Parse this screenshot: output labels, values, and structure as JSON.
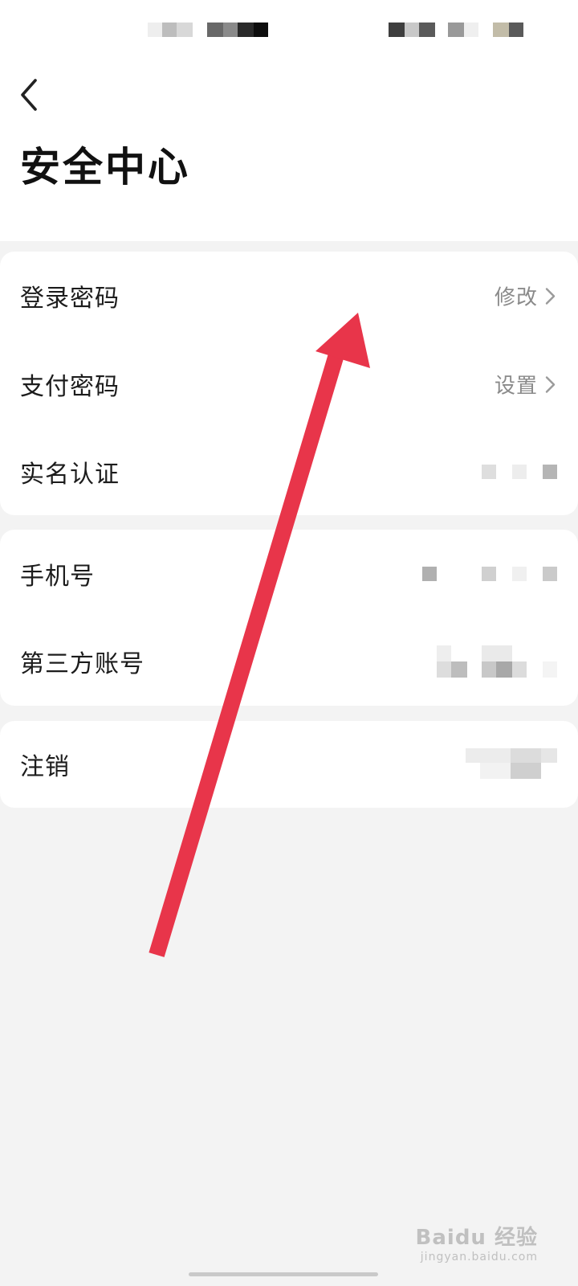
{
  "header": {
    "title": "安全中心",
    "back_icon": "chevron-left-icon"
  },
  "groups": [
    {
      "rows": [
        {
          "label": "登录密码",
          "action": "修改",
          "icon": "chevron-right-icon"
        },
        {
          "label": "支付密码",
          "action": "设置",
          "icon": "chevron-right-icon"
        },
        {
          "label": "实名认证"
        }
      ]
    },
    {
      "rows": [
        {
          "label": "手机号"
        },
        {
          "label": "第三方账号"
        }
      ]
    },
    {
      "rows": [
        {
          "label": "注销"
        }
      ]
    }
  ],
  "annotation": {
    "arrow_color": "#e8354a"
  },
  "watermark": {
    "brand": "Baidu 经验",
    "domain": "jingyan.baidu.com"
  }
}
